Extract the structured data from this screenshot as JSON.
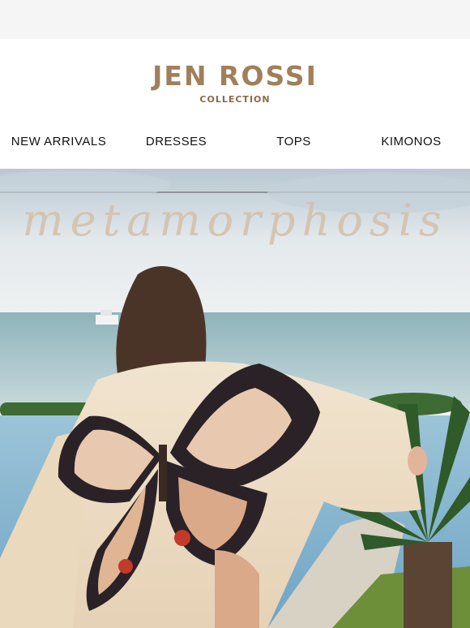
{
  "brand": {
    "name": "JEN ROSSI",
    "subtitle": "COLLECTION",
    "color": "#a0805a"
  },
  "nav": {
    "items": [
      {
        "label": "NEW ARRIVALS"
      },
      {
        "label": "DRESSES"
      },
      {
        "label": "TOPS"
      },
      {
        "label": "KIMONOS"
      }
    ]
  },
  "hero": {
    "title": "metamorphosis",
    "image_description": "hero-photo-woman-in-butterfly-kimono-by-ocean",
    "colors": {
      "sky": "#dfe6ea",
      "sea": "#a9c4c9",
      "kimono": "#efe0c8",
      "wing_dark": "#2a2226",
      "wing_light": "#e8c9b0",
      "wing_accent": "#c23a2a",
      "palm": "#2f5a2a"
    }
  }
}
